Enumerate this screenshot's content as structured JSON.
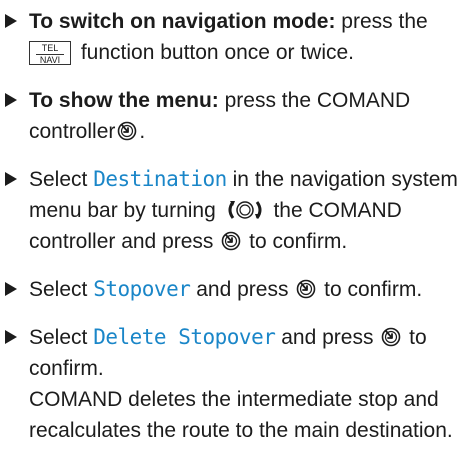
{
  "steps": [
    {
      "label": "To switch on navigation mode:",
      "text_a": "press the",
      "key_top": "TEL",
      "key_bottom": "NAVI",
      "text_b": "function button once or twice."
    },
    {
      "label": "To show the menu:",
      "text_a": "press the COMAND controller",
      "text_b": "."
    },
    {
      "text_a": "Select",
      "item": "Destination",
      "text_b": "in the navigation system menu bar by turning",
      "text_c": "the COMAND controller and press",
      "text_d": "to confirm."
    },
    {
      "text_a": "Select",
      "item": "Stopover",
      "text_b": "and press",
      "text_c": "to confirm."
    },
    {
      "text_a": "Select",
      "item": "Delete Stopover",
      "text_b": "and press",
      "text_c": "to confirm.",
      "result": "COMAND deletes the intermediate stop and recalculates the route to the main destination."
    }
  ],
  "icons": {
    "bullet": "right-triangle-bullet",
    "key": "tel-navi-key-icon",
    "press": "controller-press-icon",
    "turn": "controller-turn-icon"
  },
  "colors": {
    "text": "#1c1c1c",
    "menu_item": "#1a86c8",
    "background": "#ffffff"
  }
}
